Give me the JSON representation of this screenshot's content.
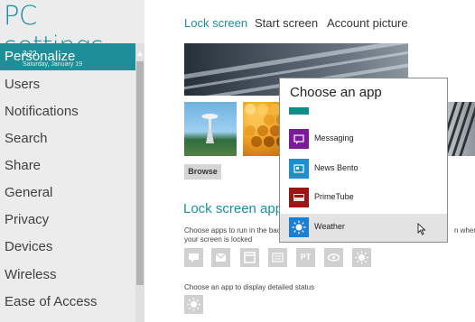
{
  "app": {
    "title": "PC settings"
  },
  "nav": {
    "items": [
      {
        "label": "Personalize",
        "selected": true
      },
      {
        "label": "Users"
      },
      {
        "label": "Notifications"
      },
      {
        "label": "Search"
      },
      {
        "label": "Share"
      },
      {
        "label": "General"
      },
      {
        "label": "Privacy"
      },
      {
        "label": "Devices"
      },
      {
        "label": "Wireless"
      },
      {
        "label": "Ease of Access"
      }
    ]
  },
  "tabs": [
    {
      "label": "Lock screen",
      "active": true
    },
    {
      "label": "Start screen"
    },
    {
      "label": "Account picture"
    }
  ],
  "preview": {
    "time": "3:22",
    "date": "Saturday, January 19"
  },
  "browse_label": "Browse",
  "lock_apps": {
    "title": "Lock screen apps",
    "desc_line1": "Choose apps to run in the bac",
    "desc_line1_right": "n when",
    "desc_line2": "your screen is locked",
    "status_desc": "Choose an app to display detailed status",
    "slot_icons": [
      "chat-icon",
      "mail-icon",
      "calendar-icon",
      "news-icon",
      "primetube-icon",
      "video-icon",
      "weather-icon"
    ],
    "slot_text_pt": "PT"
  },
  "popup": {
    "title": "Choose an app",
    "apps": [
      {
        "label": "Messaging",
        "icon": "messaging-icon",
        "color": "#7a1b9b"
      },
      {
        "label": "News Bento",
        "icon": "news-bento-icon",
        "color": "#1b8fd0"
      },
      {
        "label": "PrimeTube",
        "icon": "primetube-icon",
        "color": "#9a1515"
      },
      {
        "label": "Weather",
        "icon": "weather-icon",
        "color": "#1b7fd6"
      }
    ]
  },
  "colors": {
    "accent": "#1b8fa1",
    "selected_bg": "#1e8f98"
  }
}
